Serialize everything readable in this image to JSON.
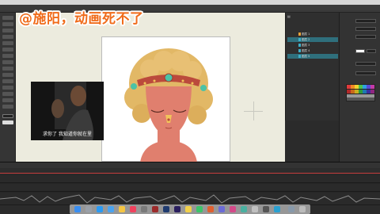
{
  "window": {
    "title": ""
  },
  "overlay": {
    "headline": "@施阳，动画死不了"
  },
  "video": {
    "subtitle": "求你了 我知道你就在里"
  },
  "layers": {
    "rows": [
      {
        "label": "图层 1",
        "color": "#e8a23a"
      },
      {
        "label": "图层 2",
        "color": "#3fb0c9"
      },
      {
        "label": "图层 3",
        "color": "#3fb0c9"
      },
      {
        "label": "图层 4",
        "color": "#3fb0c9"
      },
      {
        "label": "图层 5",
        "color": "#3fb0c9"
      }
    ]
  },
  "colors": {
    "accent": "#f06b1a",
    "stage": "#ecebde",
    "hair": "#e2b866",
    "skin": "#e07f6e",
    "crown": "#bb4a3c",
    "gem": "#4bc2a6"
  },
  "dock": {
    "apps": [
      "finder",
      "launchpad",
      "safari",
      "mail",
      "photos",
      "music",
      "settings",
      "animate",
      "photoshop",
      "premiere",
      "notes",
      "trash"
    ]
  }
}
